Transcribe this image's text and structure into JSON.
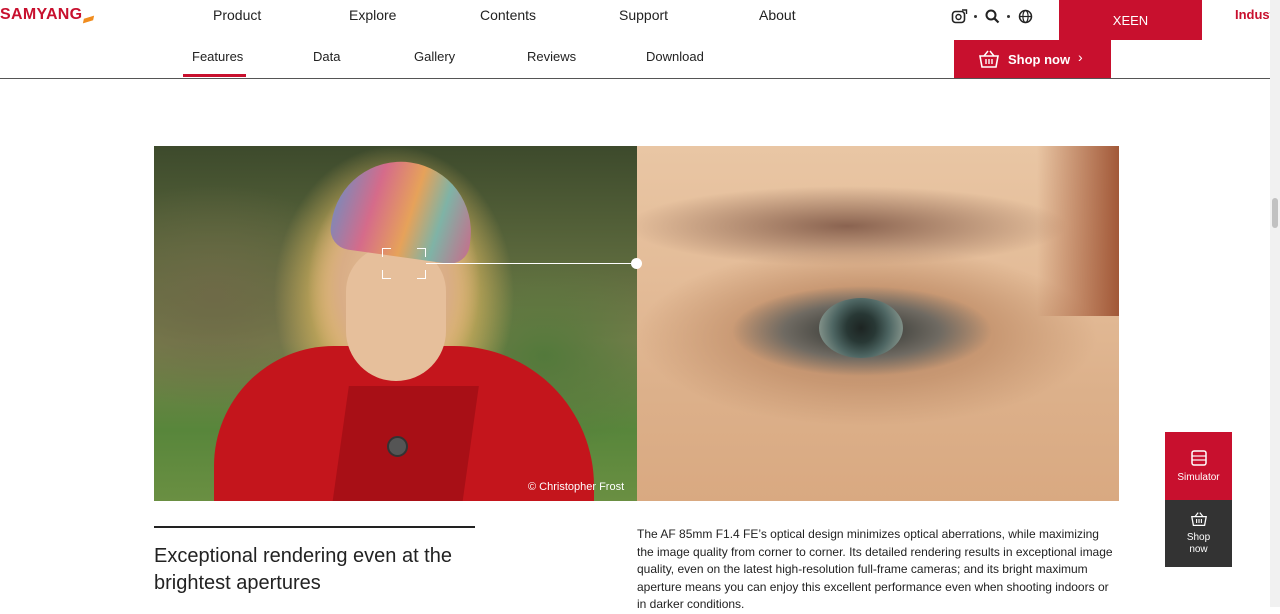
{
  "header": {
    "logo": "SAMYANG",
    "nav": [
      "Product",
      "Explore",
      "Contents",
      "Support",
      "About"
    ],
    "icons": [
      "camera-compare-icon",
      "search-icon",
      "globe-icon"
    ],
    "xeen": "XEEN",
    "industrial": "Indust"
  },
  "subnav": {
    "tabs": [
      "Features",
      "Data",
      "Gallery",
      "Reviews",
      "Download"
    ],
    "active_tab": "Features",
    "shop_now": "Shop now"
  },
  "hero": {
    "credit": "© Christopher Frost"
  },
  "content": {
    "headline": "Exceptional rendering even at the brightest apertures",
    "body": "The AF 85mm F1.4 FE’s optical design minimizes optical aberrations, while maximizing the image quality from corner to corner. Its detailed rendering results in exceptional image quality, even on the latest high-resolution full-frame cameras; and its bright maximum aperture means you can enjoy this excellent performance even when shooting indoors or in darker conditions."
  },
  "quick_menu": {
    "simulator": "Simulator",
    "shop_now": "Shop now"
  },
  "colors": {
    "brand_red": "#c8102e",
    "dark": "#333333"
  }
}
